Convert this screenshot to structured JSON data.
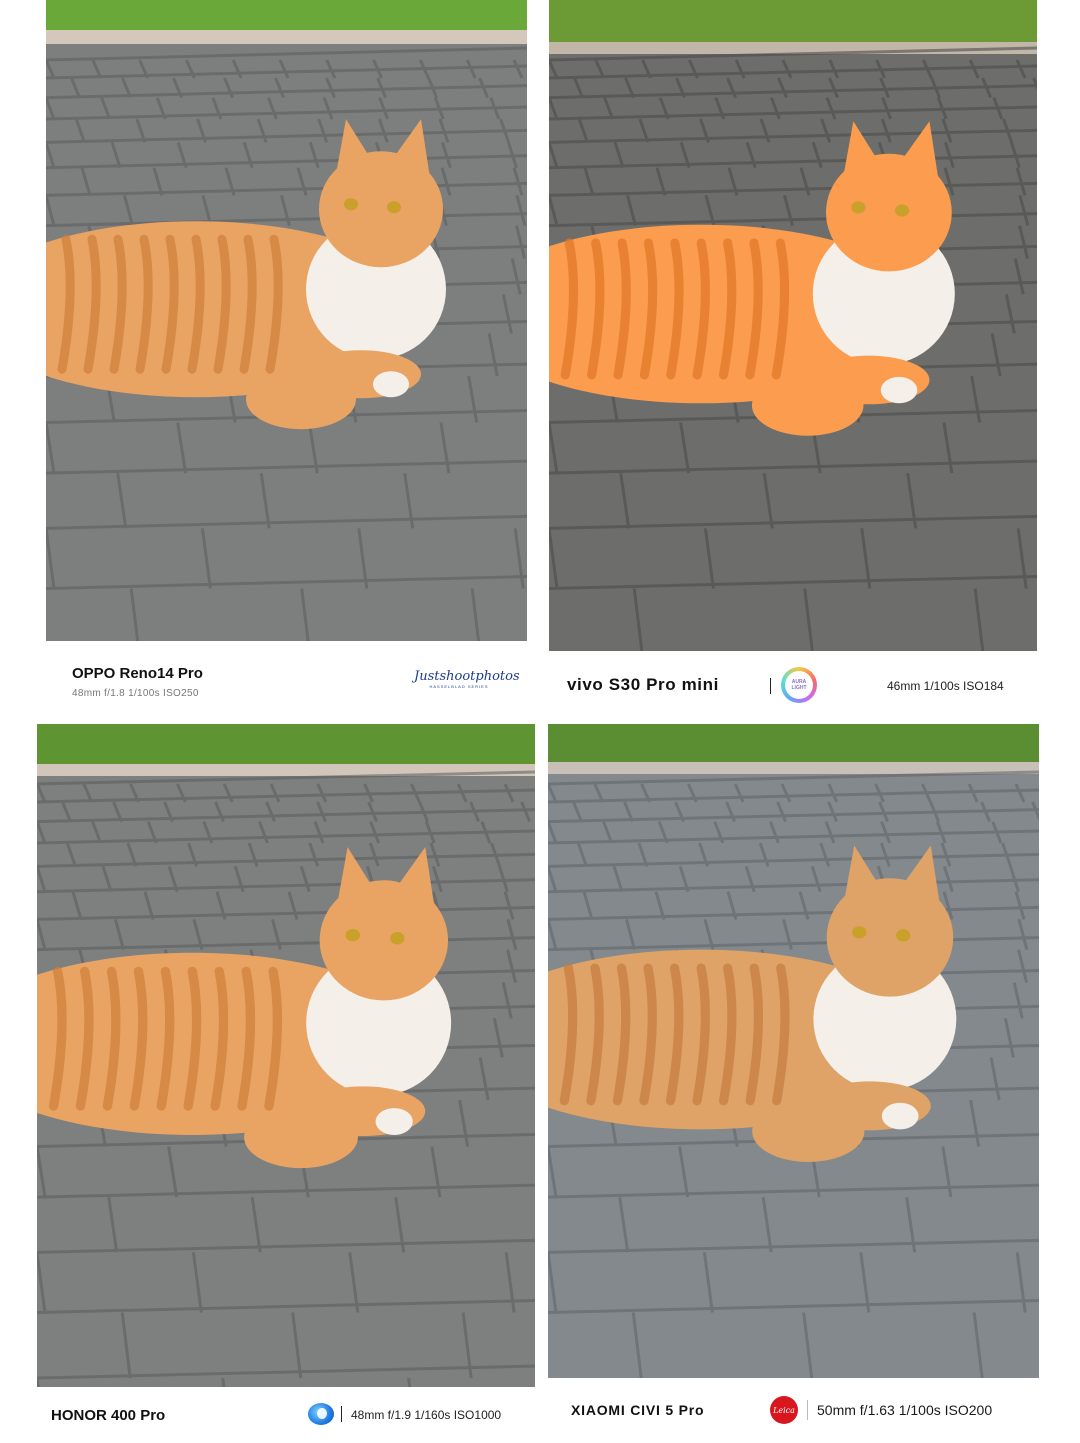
{
  "panels": [
    {
      "id": "oppo",
      "model": "OPPO Reno14 Pro",
      "exif": "48mm  f/1.8  1/100s  ISO250",
      "watermark": "Justshootphotos",
      "watermark_sub": "HASSELBLAD SERIES",
      "tone": "neutral"
    },
    {
      "id": "vivo",
      "model": "vivo S30 Pro mini",
      "logo_text": "AURA LIGHT",
      "exif": "46mm  1/100s  ISO184",
      "tone": "warm"
    },
    {
      "id": "honor",
      "model": "HONOR 400 Pro",
      "exif": "48mm  f/1.9  1/160s  ISO1000",
      "tone": "neutral"
    },
    {
      "id": "xiaomi",
      "model": "XIAOMI CIVI 5 Pro",
      "logo_text": "Leica",
      "exif": "50mm  f/1.63  1/100s  ISO200",
      "tone": "cool"
    }
  ],
  "colors": {
    "grass": "#5f9a33",
    "pavement": "#7c7e7d",
    "cat_fur": "#e9a463",
    "cat_stripe": "#cf7e3b",
    "cat_white": "#f4efe8",
    "leica_red": "#d8161d"
  }
}
